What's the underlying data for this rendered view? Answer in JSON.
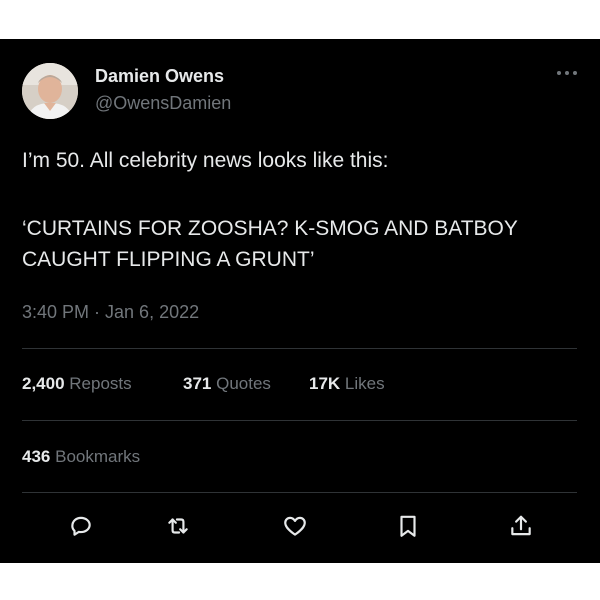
{
  "author": {
    "name": "Damien Owens",
    "handle": "@OwensDamien"
  },
  "more_icon": "more-horizontal-icon",
  "tweet": {
    "lines": [
      "I’m 50. All celebrity news looks like this:",
      "‘CURTAINS FOR ZOOSHA? K-SMOG AND BATBOY",
      "CAUGHT FLIPPING A GRUNT’"
    ],
    "timestamp": "3:40 PM · Jan 6, 2022"
  },
  "stats": {
    "reposts_count": "2,400",
    "reposts_label": "Reposts",
    "quotes_count": "371",
    "quotes_label": "Quotes",
    "likes_count": "17K",
    "likes_label": "Likes",
    "bookmarks_count": "436",
    "bookmarks_label": "Bookmarks"
  },
  "actions": [
    "reply-icon",
    "repost-icon",
    "like-icon",
    "bookmark-icon",
    "share-icon"
  ],
  "colors": {
    "background": "#000000",
    "text": "#e7e9ea",
    "secondary": "#71767b",
    "divider": "#2f3336"
  }
}
